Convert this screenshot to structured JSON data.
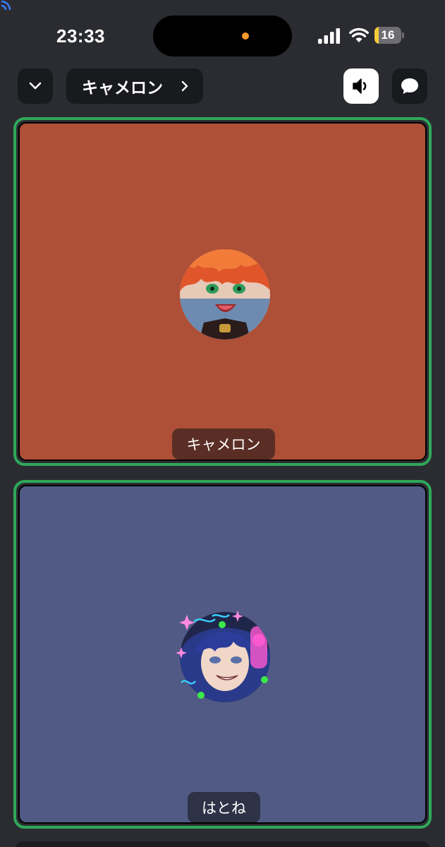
{
  "status_bar": {
    "time": "23:33",
    "battery_level": "16",
    "battery_fraction": 0.16,
    "icons": [
      "listening-icon",
      "cellular-signal-icon",
      "wifi-icon",
      "battery-icon"
    ],
    "recording_indicator_color": "#f59a2e"
  },
  "top_bar": {
    "room_name": "キャメロン",
    "icons": [
      "chevron-down-icon",
      "chevron-right-icon",
      "speaker-icon",
      "chat-bubble-icon"
    ]
  },
  "participants": [
    {
      "name": "キャメロン",
      "tile_color": "#ad5037",
      "speaking": true
    },
    {
      "name": "はとね",
      "tile_color": "#515a84",
      "speaking": true
    }
  ],
  "colors": {
    "background": "#2b2c31",
    "speaking_border": "#2fa85a",
    "button_dark": "#191a1d"
  }
}
